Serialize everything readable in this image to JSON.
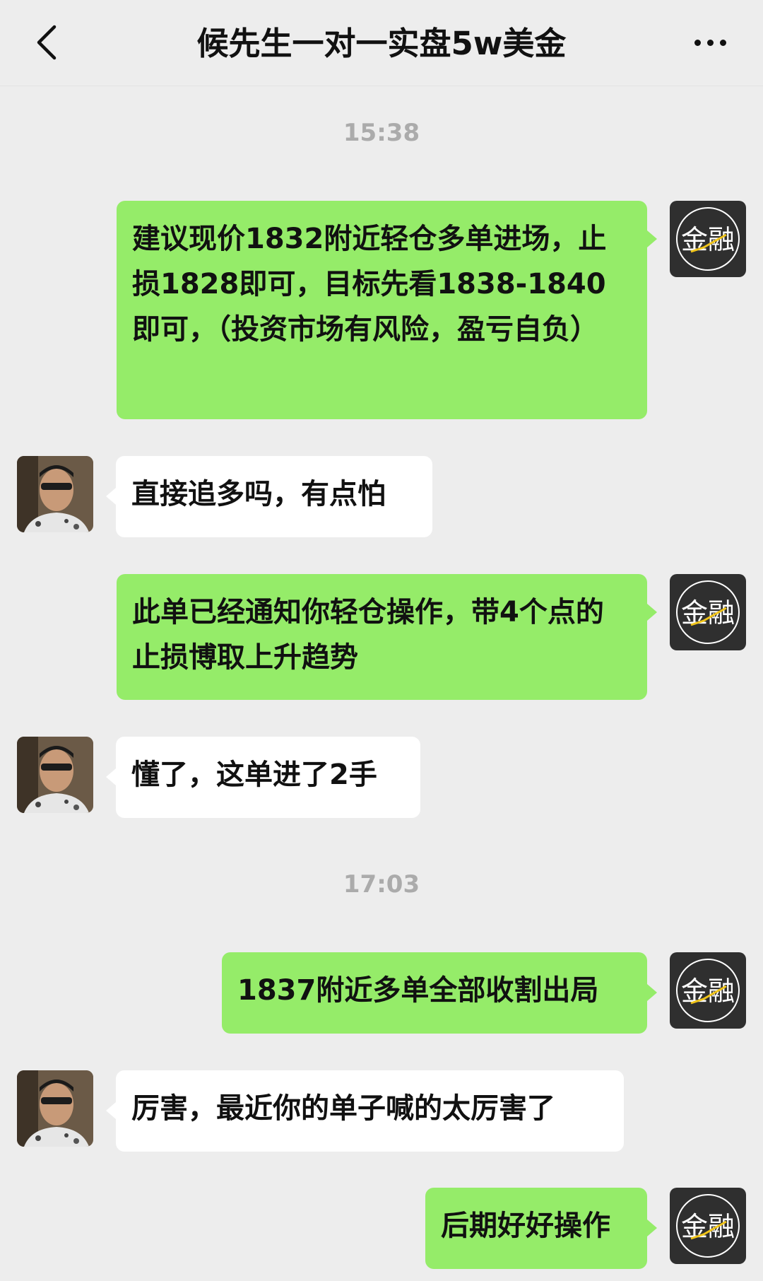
{
  "header": {
    "title": "候先生一对一实盘5w美金",
    "back_icon": "chevron-left-icon",
    "more_icon": "more-horizontal-icon"
  },
  "brand_avatar": {
    "text": "金融",
    "bg": "#2f2f2f",
    "accent": "#f0c419"
  },
  "colors": {
    "mine_bubble": "#95ec69",
    "theirs_bubble": "#ffffff",
    "background": "#ededed",
    "timestamp": "#ababab"
  },
  "timestamps": [
    "15:38",
    "17:03"
  ],
  "messages": [
    {
      "from": "me",
      "text": "建议现价1832附近轻仓多单进场，止损1828即可，目标先看1838-1840即可，（投资市场有风险，盈亏自负）"
    },
    {
      "from": "them",
      "text": "直接追多吗，有点怕"
    },
    {
      "from": "me",
      "text": "此单已经通知你轻仓操作，带4个点的止损博取上升趋势"
    },
    {
      "from": "them",
      "text": "懂了，这单进了2手"
    },
    {
      "from": "me",
      "text": "1837附近多单全部收割出局"
    },
    {
      "from": "them",
      "text": "厉害，最近你的单子喊的太厉害了"
    },
    {
      "from": "me",
      "text": "后期好好操作"
    }
  ]
}
